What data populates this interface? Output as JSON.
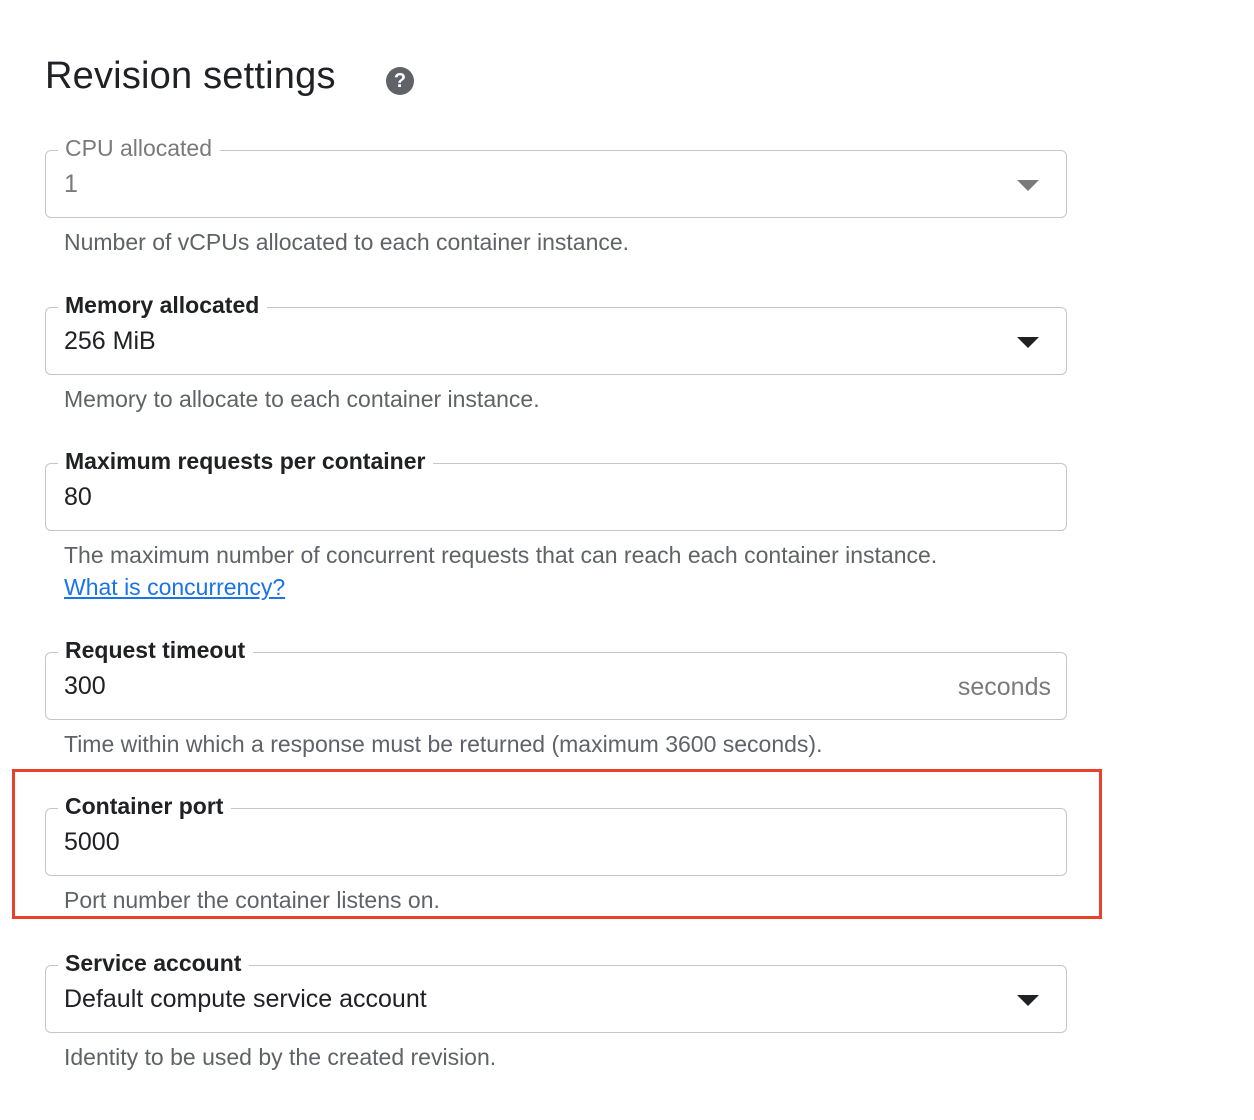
{
  "header": {
    "title": "Revision settings",
    "help_icon_glyph": "?"
  },
  "fields": {
    "cpu": {
      "label": "CPU allocated",
      "value": "1",
      "hint": "Number of vCPUs allocated to each container instance.",
      "disabled": true
    },
    "memory": {
      "label": "Memory allocated",
      "value": "256 MiB",
      "hint": "Memory to allocate to each container instance."
    },
    "max_requests": {
      "label": "Maximum requests per container",
      "value": "80",
      "hint": "The maximum number of concurrent requests that can reach each container instance.",
      "link": "What is concurrency?"
    },
    "timeout": {
      "label": "Request timeout",
      "value": "300",
      "suffix": "seconds",
      "hint": "Time within which a response must be returned (maximum 3600 seconds)."
    },
    "port": {
      "label": "Container port",
      "value": "5000",
      "hint": "Port number the container listens on."
    },
    "service_account": {
      "label": "Service account",
      "value": "Default compute service account",
      "hint": "Identity to be used by the created revision."
    }
  },
  "colors": {
    "highlight_border": "#e8412c",
    "link": "#1a73e8",
    "help_icon_bg": "#5f6368"
  }
}
